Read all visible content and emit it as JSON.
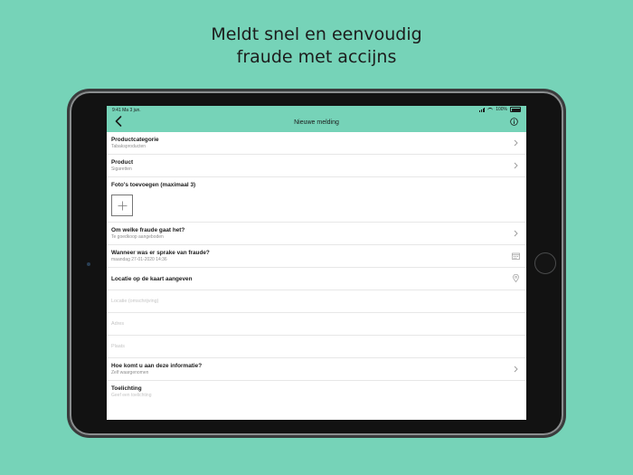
{
  "headline": {
    "line1": "Meldt snel en eenvoudig",
    "line2": "fraude met accijns"
  },
  "status_bar": {
    "time": "9:41  Ma 3 jun.",
    "battery": "100%"
  },
  "navbar": {
    "title": "Nieuwe melding",
    "back_icon": "chevron-left-icon",
    "info_icon": "info-icon"
  },
  "form": {
    "productcategorie": {
      "label": "Productcategorie",
      "value": "Tabaksproducten"
    },
    "product": {
      "label": "Product",
      "value": "Sigaretten"
    },
    "photos": {
      "label": "Foto's toevoegen (maximaal 3)",
      "add_icon": "plus-icon"
    },
    "fraude_type": {
      "label": "Om welke fraude gaat het?",
      "value": "Te goedkoop aangeboden"
    },
    "wanneer": {
      "label": "Wanneer was er sprake van fraude?",
      "value": "maandag 27-01-2020 14:36"
    },
    "locatie": {
      "label": "Locatie op de kaart aangeven"
    },
    "locatie_omschrijving": {
      "placeholder": "Locatie (omschrijving)"
    },
    "adres": {
      "placeholder": "Adres"
    },
    "plaats": {
      "placeholder": "Plaats"
    },
    "informatie_bron": {
      "label": "Hoe komt u aan deze informatie?",
      "value": "Zelf waargenomen"
    },
    "toelichting": {
      "label": "Toelichting",
      "placeholder": "Geef een toelichting"
    }
  },
  "colors": {
    "background": "#76d3b8",
    "navbar": "#76d3b8"
  }
}
